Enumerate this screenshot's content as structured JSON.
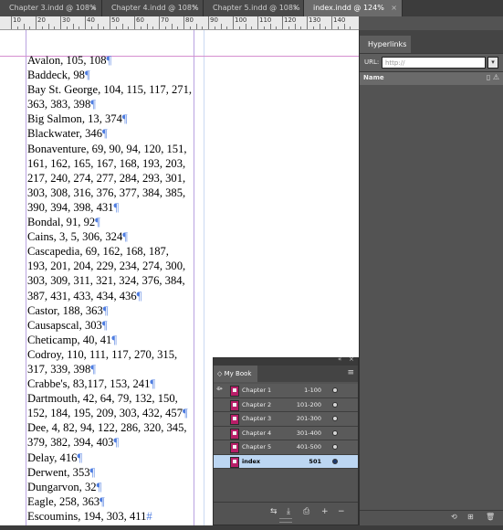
{
  "tabs": [
    {
      "label": "Chapter 3.indd @ 108%",
      "active": false
    },
    {
      "label": "Chapter 4.indd @ 108%",
      "active": false
    },
    {
      "label": "Chapter 5.indd @ 108%",
      "active": false
    },
    {
      "label": "index.indd @ 124%",
      "active": true
    }
  ],
  "ruler": {
    "labels": [
      "10",
      "20",
      "30",
      "40",
      "50",
      "60",
      "70",
      "80",
      "90",
      "100",
      "110",
      "120",
      "130",
      "140"
    ]
  },
  "index_entries": [
    "Avalon, 105, 108",
    "Baddeck, 98",
    "Bay St. George, 104, 115, 117, 271,",
    "363, 383, 398",
    "Big Salmon, 13, 374",
    "Blackwater, 346",
    "Bonaventure, 69, 90, 94, 120, 151,",
    "161, 162, 165, 167, 168, 193, 203,",
    "217, 240, 274, 277, 284, 293, 301,",
    "303, 308, 316, 376, 377, 384, 385,",
    "390, 394, 398, 431",
    "Bondal, 91, 92",
    "Cains, 3, 5, 306, 324",
    "Cascapedia, 69, 162, 168, 187,",
    "193, 201, 204, 229, 234, 274, 300,",
    "303, 309, 311, 321, 324, 376, 384,",
    "387, 431, 433, 434, 436",
    "Castor, 188, 363",
    "Causapscal, 303",
    "Cheticamp, 40, 41",
    "Codroy, 110, 111, 117, 270, 315,",
    "317, 339, 398",
    "Crabbe's, 83,117, 153, 241",
    "Dartmouth, 42, 64, 79, 132, 150,",
    "152, 184, 195, 209, 303, 432, 457",
    "Dee, 4, 82, 94, 122, 286, 320, 345,",
    "379, 382, 394, 403",
    "Delay, 416",
    "Derwent, 353",
    "Dungarvon, 32",
    "Eagle, 258, 363",
    "Escoumins, 194, 303, 411"
  ],
  "entry_marks": [
    "¶",
    "¶",
    "",
    "¶",
    "¶",
    "¶",
    "",
    "",
    "",
    "",
    "¶",
    "¶",
    "¶",
    "",
    "",
    "",
    "¶",
    "¶",
    "¶",
    "¶",
    "",
    "¶",
    "¶",
    "",
    "¶",
    "",
    "¶",
    "¶",
    "¶",
    "¶",
    "¶",
    "#"
  ],
  "hyperlinks": {
    "tab": "Hyperlinks",
    "url_label": "URL:",
    "url_placeholder": "http://",
    "name_header": "Name"
  },
  "book": {
    "tab": "My Book",
    "chapters": [
      {
        "name": "Chapter 1",
        "pages": "1-100",
        "selected": false
      },
      {
        "name": "Chapter 2",
        "pages": "101-200",
        "selected": false
      },
      {
        "name": "Chapter 3",
        "pages": "201-300",
        "selected": false
      },
      {
        "name": "Chapter 4",
        "pages": "301-400",
        "selected": false
      },
      {
        "name": "Chapter 5",
        "pages": "401-500",
        "selected": false
      },
      {
        "name": "index",
        "pages": "501",
        "selected": true
      }
    ]
  },
  "colors": {
    "selection": "#bcd6f2",
    "pilcrow": "#4f7de0",
    "doc_icon": "#b81e68"
  }
}
